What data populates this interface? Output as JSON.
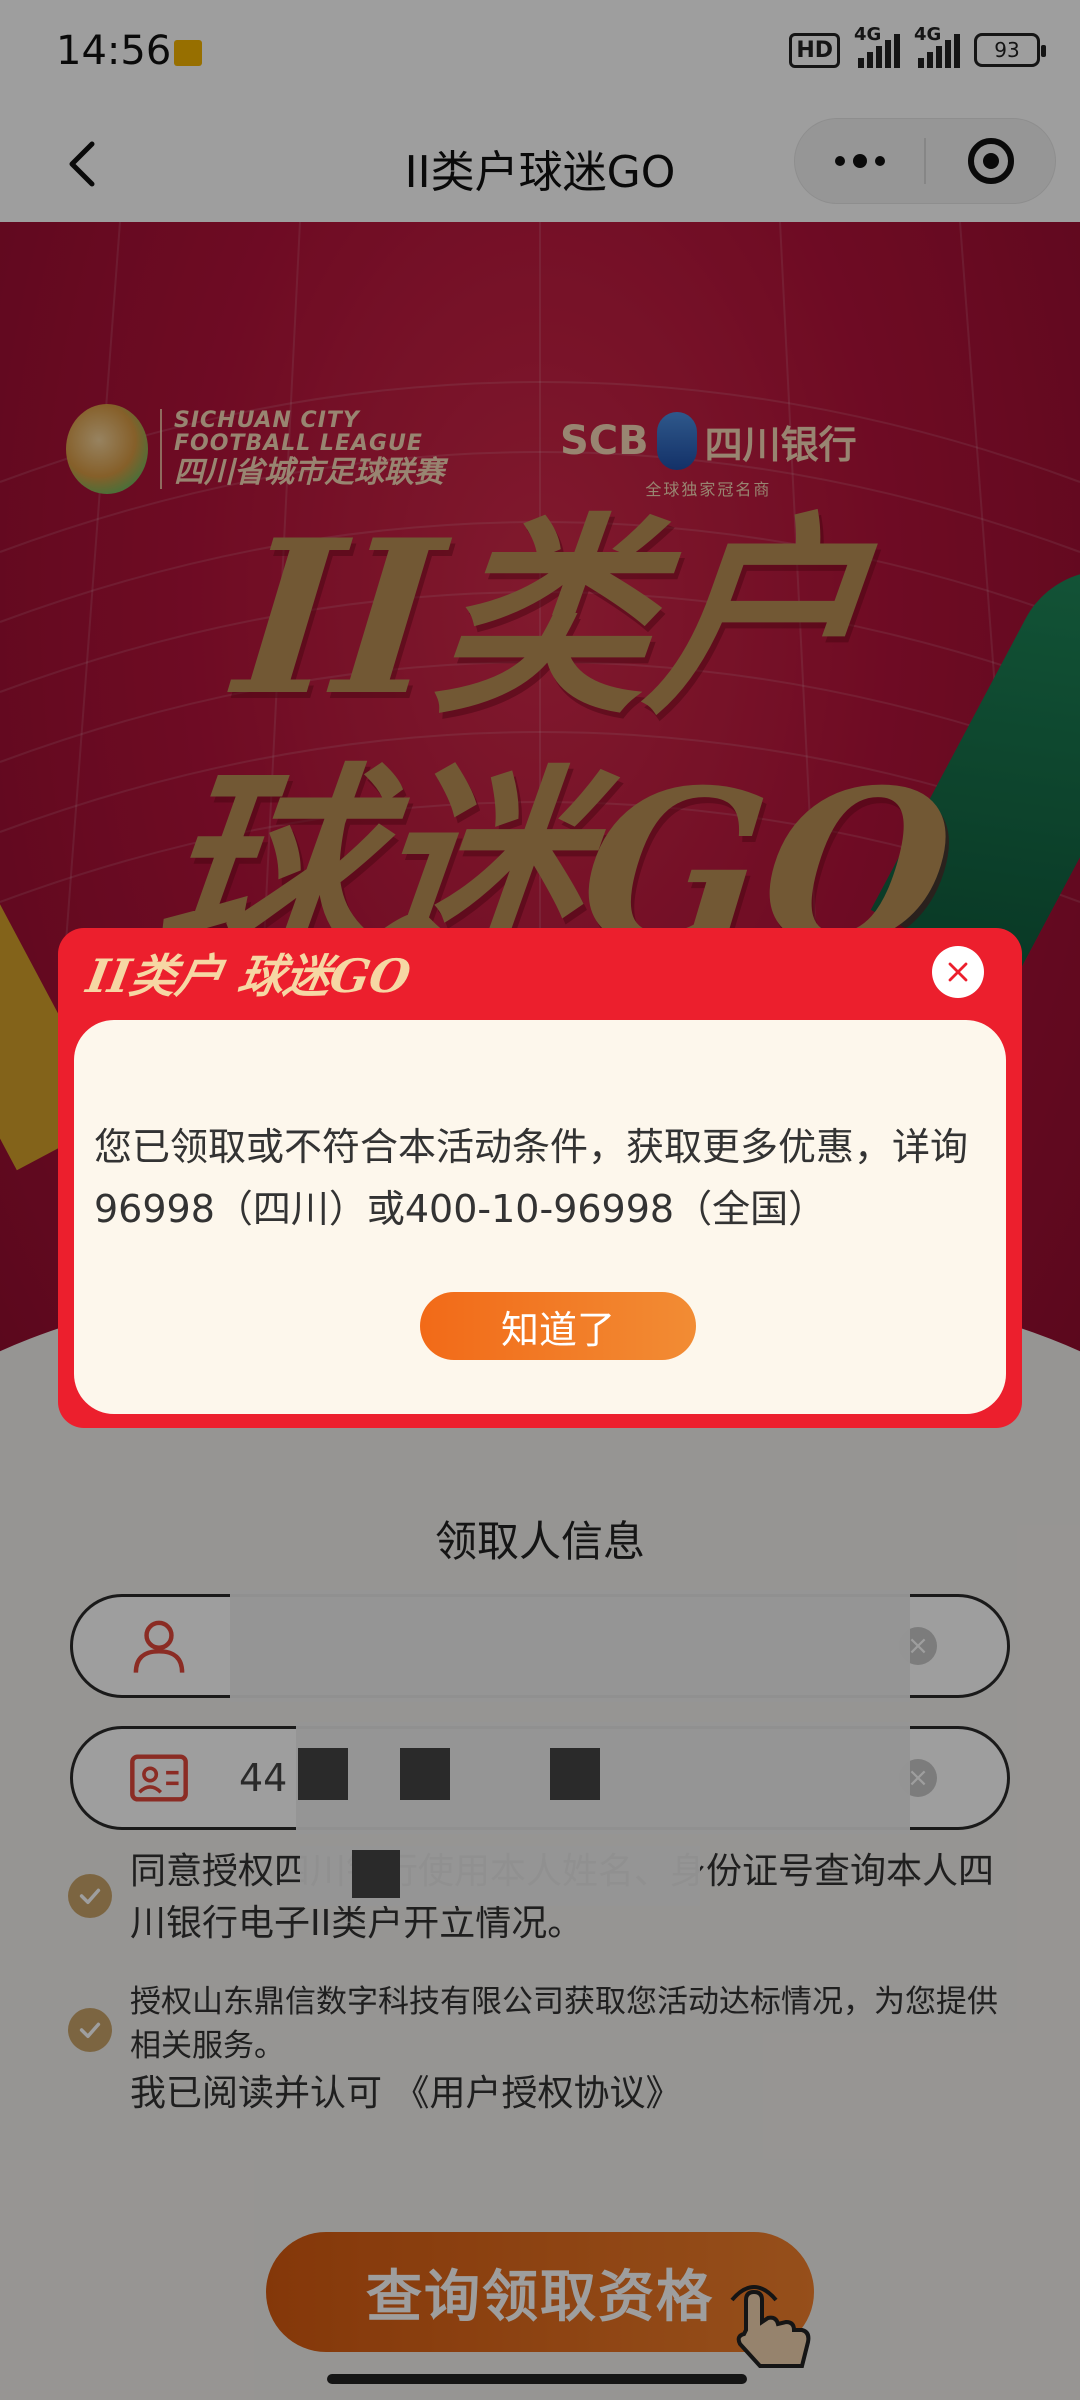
{
  "status_bar": {
    "time": "14:56",
    "hd_badge": "HD",
    "network_1": "4G",
    "network_2": "4G",
    "battery": "93"
  },
  "nav": {
    "title": "II类户球迷GO",
    "back_icon": "chevron-left-icon",
    "more_icon": "more-dots-icon",
    "close_icon": "target-circle-icon"
  },
  "hero": {
    "league_en": "SICHUAN CITY FOOTBALL LEAGUE",
    "league_cn": "四川省城市足球联赛",
    "bank_scb": "SCB",
    "bank_cn": "四川银行",
    "bank_sub": "全球独家冠名商",
    "title_line1": "II类户",
    "title_line2": "球迷GO"
  },
  "form": {
    "section_title": "领取人信息",
    "name_value": "",
    "id_value": "44",
    "agree_1": "同意授权四川银行使用本人姓名、身份证号查询本人四川银行电子II类户开立情况。",
    "agree_2": "授权山东鼎信数字科技有限公司获取您活动达标情况，为您提供相关服务。",
    "agree_2_read": "我已阅读并认可",
    "agree_2_link": "《用户授权协议》",
    "cta": "查询领取资格"
  },
  "modal": {
    "brand": "II类户 球迷GO",
    "message": "您已领取或不符合本活动条件，获取更多优惠，详询96998（四川）或400-10-96998（全国）",
    "button": "知道了"
  },
  "colors": {
    "brand_red": "#ec1f2d",
    "hero_red": "#b3133a",
    "gold": "#b98e55",
    "cta_orange": "#f2802c"
  }
}
